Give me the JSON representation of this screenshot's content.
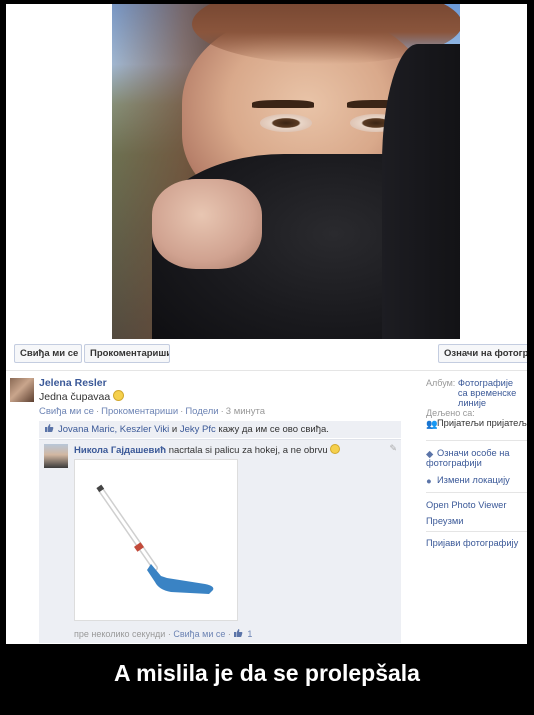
{
  "photo_buttons": {
    "like": "Свиђа ми се",
    "comment": "Прокоментариши",
    "tag": "Означи на фотографији"
  },
  "post": {
    "author": "Jelena Resler",
    "text": "Jedna čupavaa",
    "actions": {
      "like": "Свиђа ми се",
      "comment": "Прокоментариши",
      "share": "Подели",
      "time": "3 минута"
    },
    "likes": {
      "names": "Jovana Maric, Keszler Viki",
      "conjunction": "и",
      "last_name": "Jeky Pfc",
      "suffix": "кажу да им се ово свиђа."
    },
    "comment": {
      "author": "Никола Гајдашевић",
      "text": "nacrtala si palicu za hokej, a ne obrvu",
      "time": "пре неколико секунди",
      "like": "Свиђа ми се",
      "like_count": "1"
    }
  },
  "sidebar": {
    "album_label": "Албум:",
    "album_value": "Фотографије са временске линије",
    "shared_label": "Дељено са:",
    "shared_value": "Пријатељи пријатеља",
    "tag_people": "Означи особе на фотографији",
    "edit_location": "Измени локацију",
    "open_viewer": "Open Photo Viewer",
    "download": "Преузми",
    "report": "Пријави фотографију"
  },
  "caption": "A mislila je da se prolepšala",
  "colors": {
    "link": "#3b5998",
    "muted": "#999999",
    "comment_bg": "#edeff4",
    "caption_bg": "#000000"
  },
  "icons": [
    "thumbs-up-icon",
    "tag-icon",
    "location-pin-icon",
    "friends-icon",
    "smiley-icon",
    "pencil-icon",
    "hockey-stick-drawing"
  ]
}
